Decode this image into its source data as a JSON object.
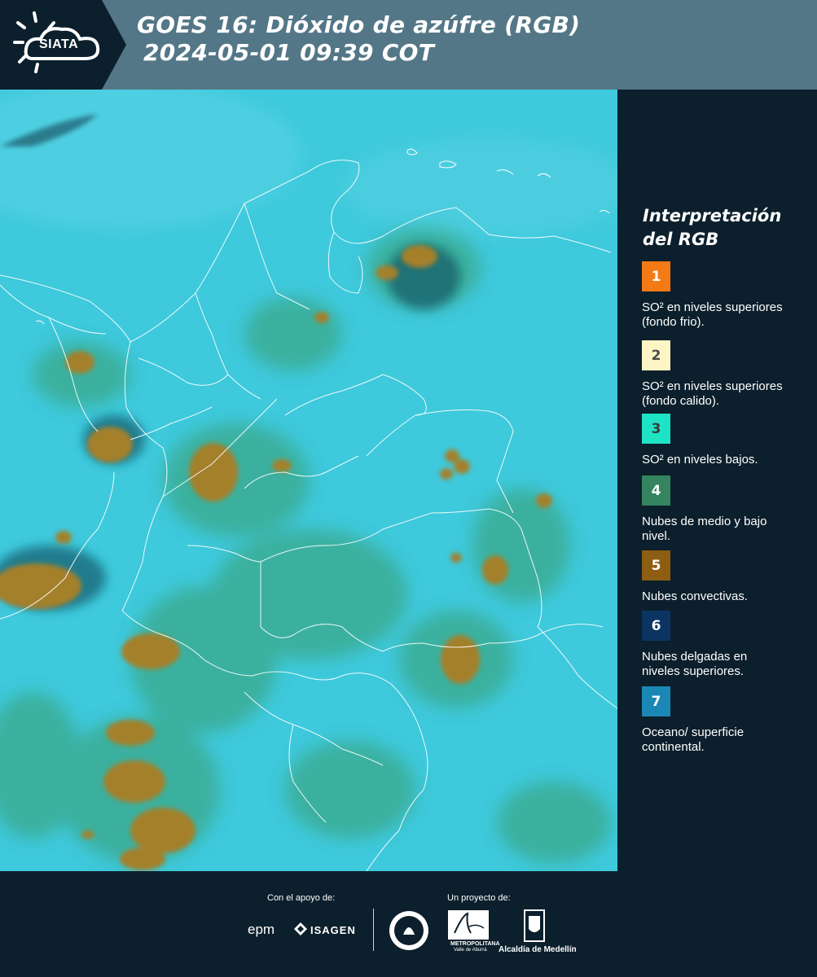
{
  "header": {
    "logo_text": "SIATA",
    "title_line1": "GOES 16: Dióxido de azúfre (RGB)",
    "title_line2": "2024-05-01 09:39 COT"
  },
  "legend": {
    "title": "Interpretación del RGB",
    "items": [
      {
        "number": "1",
        "color": "#f47a16",
        "text_color": "#ffffff",
        "label": "SO² en niveles superiores (fondo frio)."
      },
      {
        "number": "2",
        "color": "#fdf6c4",
        "text_color": "#4a4a4a",
        "label": "SO² en niveles superiores (fondo calido)."
      },
      {
        "number": "3",
        "color": "#1ee3c4",
        "text_color": "#3a3a3a",
        "label": "SO² en niveles bajos."
      },
      {
        "number": "4",
        "color": "#33845f",
        "text_color": "#ffffff",
        "label": "Nubes de medio y bajo nivel."
      },
      {
        "number": "5",
        "color": "#8d5d12",
        "text_color": "#ffffff",
        "label": "Nubes convectivas."
      },
      {
        "number": "6",
        "color": "#0b3462",
        "text_color": "#ffffff",
        "label": "Nubes delgadas en niveles superiores."
      },
      {
        "number": "7",
        "color": "#1b87b5",
        "text_color": "#ffffff",
        "label": "Oceano/ superficie continental."
      }
    ]
  },
  "footer": {
    "support_label": "Con el apoyo de:",
    "project_label": "Un proyecto de:",
    "partner_epm": "epm",
    "partner_isagen": "ISAGEN",
    "partner_area_caption": "METROPOLITANA",
    "partner_area_sub": "Valle de Aburrá",
    "partner_alcaldia": "Alcaldía de Medellín"
  },
  "map": {
    "ocean_color": "#3ec9dc",
    "cloud_convective_color": "#9c7a2a",
    "cloud_low_color": "#3fae8a",
    "border_color": "#ffffff"
  }
}
